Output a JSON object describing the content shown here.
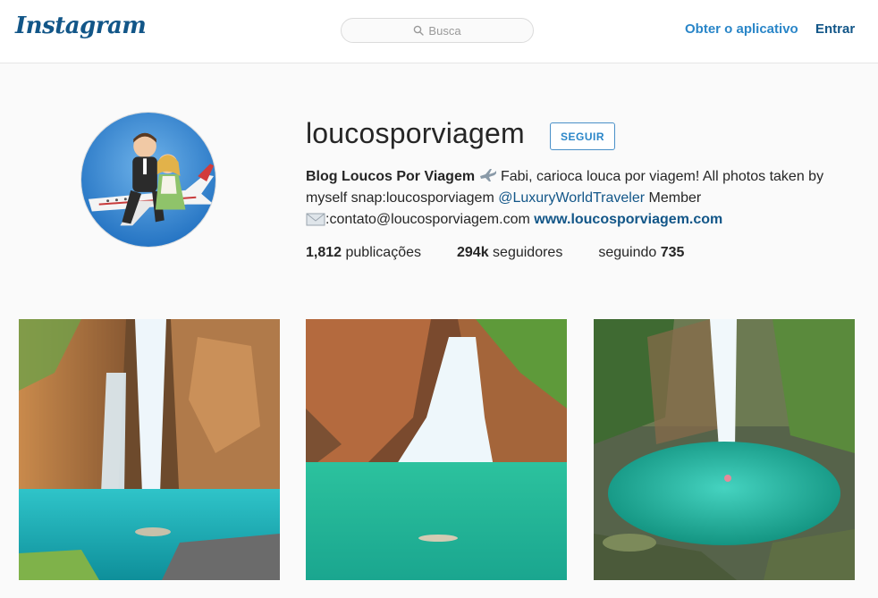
{
  "header": {
    "logo": "Instagram",
    "search_placeholder": "Busca",
    "get_app": "Obter o aplicativo",
    "login": "Entrar"
  },
  "profile": {
    "username": "loucosporviagem",
    "follow_label": "SEGUIR",
    "bio": {
      "name": "Blog Loucos Por Viagem",
      "line1_rest": "Fabi, carioca louca por viagem! All photos taken by myself snap:loucosporviagem",
      "mention": "@LuxuryWorldTraveler",
      "after_mention": "Member",
      "contact": ":contato@loucosporviagem.com",
      "website": "www.loucosporviagem.com"
    },
    "stats": {
      "posts_count": "1,812",
      "posts_label": "publicações",
      "followers_count": "294k",
      "followers_label": "seguidores",
      "following_label": "seguindo",
      "following_count": "735"
    }
  },
  "posts": [
    {
      "subject": "waterfall-canyon-swimmers"
    },
    {
      "subject": "waterfall-pool-swimmer"
    },
    {
      "subject": "waterfall-turquoise-pool"
    }
  ],
  "colors": {
    "brand": "#125688",
    "link": "#2a86c8",
    "text": "#262626",
    "background": "#fafafa"
  }
}
